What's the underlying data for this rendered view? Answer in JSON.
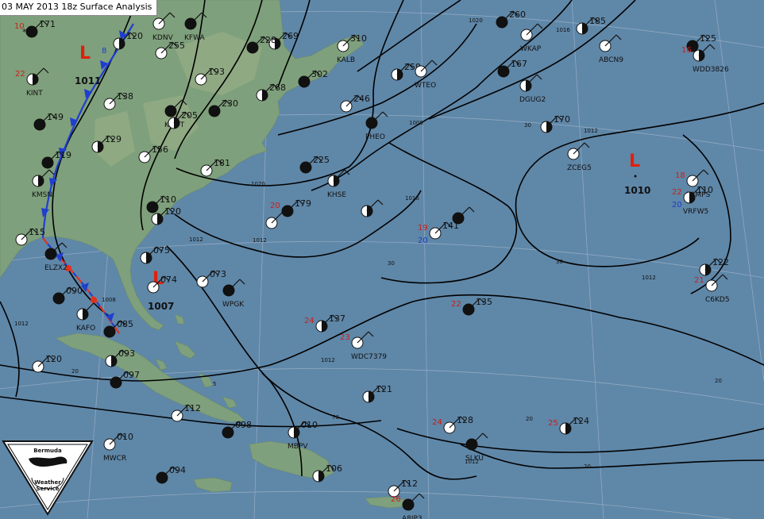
{
  "map": {
    "title": "03 MAY 2013 18z Surface Analysis",
    "colors": {
      "ocean": "#5f87a8",
      "land": "#7fa07c",
      "land_high": "#96ad86",
      "isobar": "#000000",
      "cold_front": "#1f3fcf",
      "warm_front": "#e0311e",
      "temperature": "#c8201c",
      "dewpoint": "#1e3cc8",
      "low_symbol": "#e0200c"
    },
    "lows": [
      {
        "label": "L",
        "pressure": "1011"
      },
      {
        "label": "L",
        "pressure": "1007"
      },
      {
        "label": "L",
        "pressure": "1010"
      }
    ],
    "isobar_labels": [
      "1020",
      "1016",
      "1012",
      "1008",
      "1020",
      "1016",
      "1012",
      "1012",
      "1012",
      "1012",
      "1012",
      "30",
      "30",
      "30",
      "1012",
      "20",
      "20",
      "20",
      "20",
      "5",
      "70",
      "1008"
    ],
    "stations": [
      {
        "id": "",
        "t": "10",
        "td": "",
        "p": "171",
        "wx": "**"
      },
      {
        "id": "",
        "t": "",
        "td": "8",
        "p": "120",
        "wx": ""
      },
      {
        "id": "KDNV",
        "t": "",
        "td": "",
        "p": "",
        "wx": ""
      },
      {
        "id": "KFWA",
        "t": "",
        "td": "",
        "p": "",
        "wx": ""
      },
      {
        "id": "",
        "t": "",
        "td": "",
        "p": "269",
        "wx": ""
      },
      {
        "id": "KALB",
        "t": "",
        "td": "",
        "p": "310",
        "wx": ""
      },
      {
        "id": "",
        "t": "",
        "td": "",
        "p": "260",
        "wx": ""
      },
      {
        "id": "",
        "t": "",
        "td": "",
        "p": "185",
        "wx": ""
      },
      {
        "id": "ABCN9",
        "t": "",
        "td": "",
        "p": "",
        "wx": ""
      },
      {
        "id": "",
        "t": "",
        "td": "",
        "p": "125",
        "wx": ""
      },
      {
        "id": "WDD3826",
        "t": "16",
        "td": "",
        "p": "",
        "wx": ""
      },
      {
        "id": "",
        "t": "",
        "td": "",
        "p": "255",
        "wx": ""
      },
      {
        "id": "",
        "t": "",
        "td": "",
        "p": "228",
        "wx": ""
      },
      {
        "id": "KINT",
        "t": "22",
        "td": "",
        "p": "",
        "wx": ""
      },
      {
        "id": "",
        "t": "",
        "td": "",
        "p": "138",
        "wx": ""
      },
      {
        "id": "KOOT",
        "t": "",
        "td": "",
        "p": "",
        "wx": ""
      },
      {
        "id": "",
        "t": "",
        "td": "",
        "p": "205",
        "wx": ""
      },
      {
        "id": "",
        "t": "",
        "td": "",
        "p": "193",
        "wx": ""
      },
      {
        "id": "",
        "t": "",
        "td": "",
        "p": "302",
        "wx": ""
      },
      {
        "id": "",
        "t": "",
        "td": "",
        "p": "259",
        "wx": ""
      },
      {
        "id": "WTEO",
        "t": "",
        "td": "",
        "p": "",
        "wx": ""
      },
      {
        "id": "",
        "t": "",
        "td": "",
        "p": "167",
        "wx": ""
      },
      {
        "id": "DGUG2",
        "t": "",
        "td": "",
        "p": "",
        "wx": ""
      },
      {
        "id": "WKAP",
        "t": "",
        "td": "",
        "p": "",
        "wx": ""
      },
      {
        "id": "",
        "t": "",
        "td": "",
        "p": "149",
        "wx": ""
      },
      {
        "id": "",
        "t": "",
        "td": "",
        "p": "129",
        "wx": ""
      },
      {
        "id": "",
        "t": "",
        "td": "",
        "p": "156",
        "wx": ""
      },
      {
        "id": "",
        "t": "",
        "td": "",
        "p": "230",
        "wx": ""
      },
      {
        "id": "",
        "t": "",
        "td": "",
        "p": "268",
        "wx": ""
      },
      {
        "id": "",
        "t": "",
        "td": "",
        "p": "246",
        "wx": ""
      },
      {
        "id": "PHEO",
        "t": "",
        "td": "",
        "p": "",
        "wx": ""
      },
      {
        "id": "",
        "t": "",
        "td": "",
        "p": "170",
        "wx": ""
      },
      {
        "id": "ZCEG5",
        "t": "",
        "td": "",
        "p": "",
        "wx": ""
      },
      {
        "id": "",
        "t": "",
        "td": "",
        "p": "119",
        "wx": ""
      },
      {
        "id": "KMSN",
        "t": "",
        "td": "",
        "p": "",
        "wx": ""
      },
      {
        "id": "",
        "t": "",
        "td": "",
        "p": "181",
        "wx": ""
      },
      {
        "id": "",
        "t": "",
        "td": "",
        "p": "225",
        "wx": ""
      },
      {
        "id": "KHSE",
        "t": "",
        "td": "",
        "p": "",
        "wx": ""
      },
      {
        "id": "LAMPS",
        "t": "18",
        "td": "",
        "p": "",
        "wx": ""
      },
      {
        "id": "",
        "t": "",
        "td": "",
        "p": "110",
        "wx": ""
      },
      {
        "id": "",
        "t": "",
        "td": "",
        "p": "120",
        "wx": ""
      },
      {
        "id": "",
        "t": "",
        "td": "",
        "p": "",
        "wx": ""
      },
      {
        "id": "",
        "t": "20",
        "td": "",
        "p": "179",
        "wx": ""
      },
      {
        "id": "",
        "t": "",
        "td": "",
        "p": "",
        "wx": ""
      },
      {
        "id": "",
        "t": "19",
        "td": "20",
        "p": "141",
        "wx": ""
      },
      {
        "id": "",
        "t": "",
        "td": "",
        "p": "",
        "wx": ""
      },
      {
        "id": "VRFW5",
        "t": "22",
        "td": "20",
        "p": "110",
        "wx": ""
      },
      {
        "id": "",
        "t": "",
        "td": "",
        "p": "115",
        "wx": ""
      },
      {
        "id": "ELZX2",
        "t": "",
        "td": "",
        "p": "",
        "wx": ""
      },
      {
        "id": "",
        "t": "",
        "td": "",
        "p": "075",
        "wx": ""
      },
      {
        "id": "",
        "t": "",
        "td": "",
        "p": "073",
        "wx": ""
      },
      {
        "id": "WPGK",
        "t": "",
        "td": "",
        "p": "",
        "wx": ""
      },
      {
        "id": "",
        "t": "",
        "td": "",
        "p": "122",
        "wx": ""
      },
      {
        "id": "C6KD5",
        "t": "21",
        "td": "",
        "p": "",
        "wx": ""
      },
      {
        "id": "",
        "t": "",
        "td": "",
        "p": "090",
        "wx": ""
      },
      {
        "id": "KAFO",
        "t": "",
        "td": "",
        "p": "",
        "wx": ""
      },
      {
        "id": "",
        "t": "",
        "td": "",
        "p": "074",
        "wx": ""
      },
      {
        "id": "",
        "t": "",
        "td": "",
        "p": "085",
        "wx": ""
      },
      {
        "id": "",
        "t": "24",
        "td": "",
        "p": "137",
        "wx": ""
      },
      {
        "id": "WDC7379",
        "t": "23",
        "td": "",
        "p": "",
        "wx": ""
      },
      {
        "id": "",
        "t": "22",
        "td": "",
        "p": "135",
        "wx": ""
      },
      {
        "id": "",
        "t": "",
        "td": "",
        "p": "093",
        "wx": ""
      },
      {
        "id": "",
        "t": "",
        "td": "",
        "p": "120",
        "wx": ""
      },
      {
        "id": "",
        "t": "",
        "td": "",
        "p": "097",
        "wx": ""
      },
      {
        "id": "",
        "t": "",
        "td": "",
        "p": "121",
        "wx": ""
      },
      {
        "id": "",
        "t": "",
        "td": "",
        "p": "112",
        "wx": ""
      },
      {
        "id": "",
        "t": "",
        "td": "",
        "p": "098",
        "wx": ""
      },
      {
        "id": "MBPV",
        "t": "",
        "td": "",
        "p": "010",
        "wx": ""
      },
      {
        "id": "",
        "t": "24",
        "td": "",
        "p": "128",
        "wx": ""
      },
      {
        "id": "SLKU",
        "t": "",
        "td": "",
        "p": "",
        "wx": ""
      },
      {
        "id": "",
        "t": "25",
        "td": "",
        "p": "124",
        "wx": ""
      },
      {
        "id": "MWCR",
        "t": "",
        "td": "",
        "p": "010",
        "wx": ""
      },
      {
        "id": "",
        "t": "",
        "td": "",
        "p": "094",
        "wx": ""
      },
      {
        "id": "",
        "t": "",
        "td": "",
        "p": "106",
        "wx": ""
      },
      {
        "id": "",
        "t": "",
        "td": "",
        "p": "112",
        "wx": ""
      },
      {
        "id": "A8IP3",
        "t": "26",
        "td": "",
        "p": "",
        "wx": ""
      }
    ],
    "logo": {
      "top_text": "Bermuda",
      "line1": "Weather",
      "line2": "Service"
    }
  }
}
